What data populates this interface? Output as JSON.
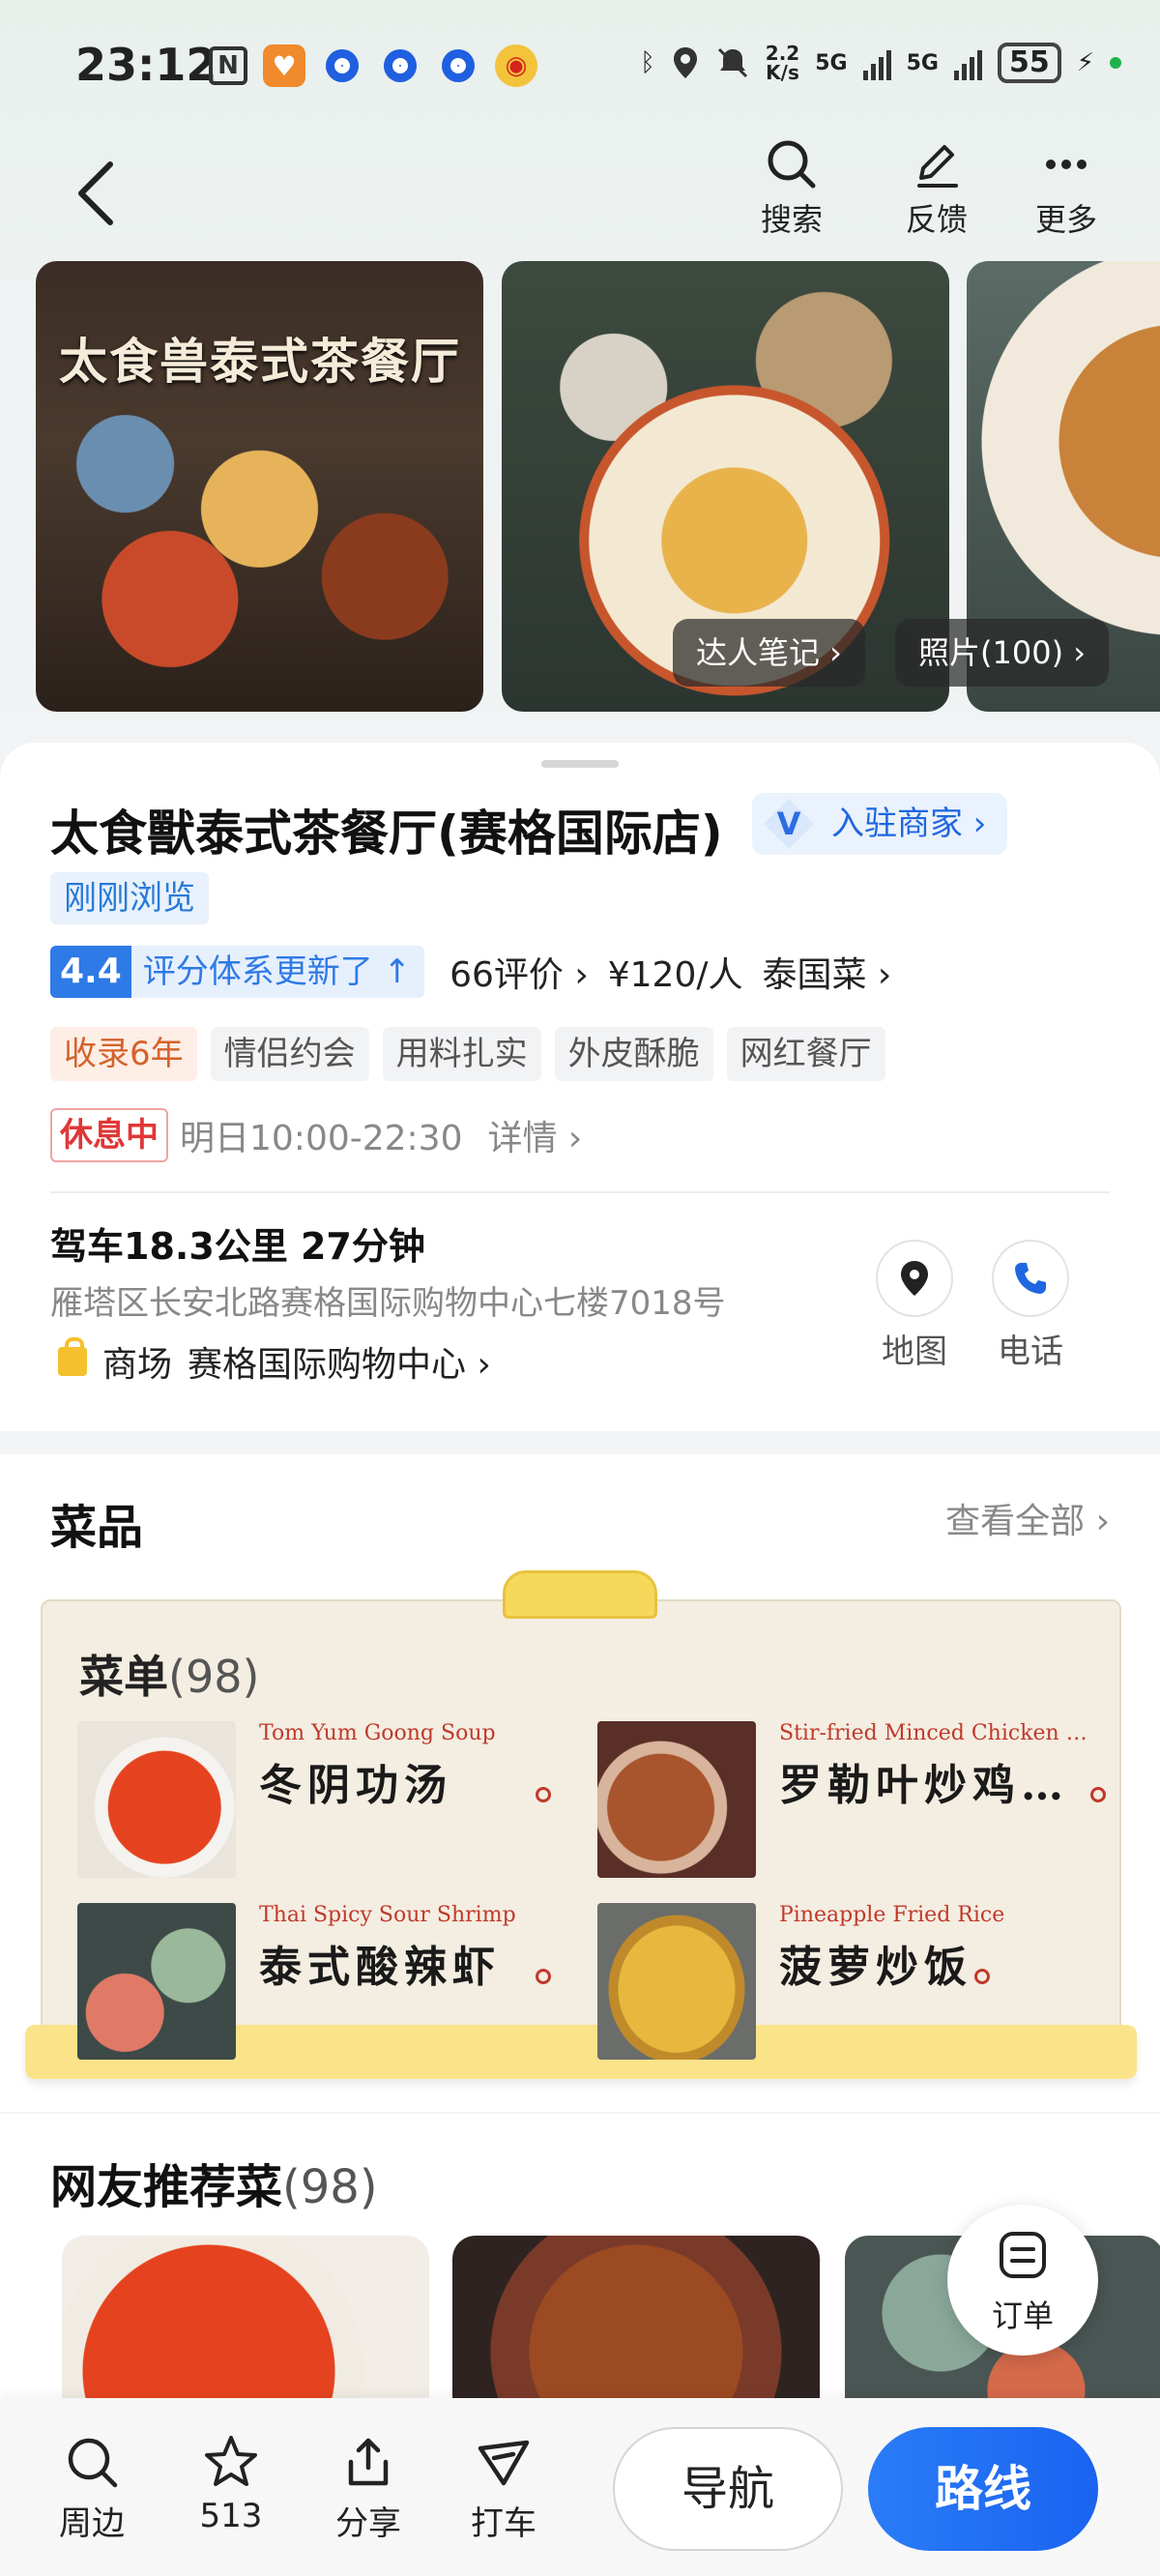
{
  "status_bar": {
    "time": "23:12",
    "net_speed_top": "2.2",
    "net_speed_bottom": "K/s",
    "network_1": "5G",
    "network_2": "5G",
    "battery": "55"
  },
  "nav": {
    "search_label": "搜索",
    "feedback_label": "反馈",
    "more_label": "更多"
  },
  "photos": {
    "photo1_text": "太食兽泰式茶餐厅",
    "notes_chip": "达人笔记 ›",
    "photos_chip": "照片(100) ›"
  },
  "shop": {
    "name": "太食獸泰式茶餐厅(赛格国际店)",
    "merchant_badge": "入驻商家 ›",
    "recent_tag": "刚刚浏览",
    "rating_score": "4.4",
    "rating_note": "评分体系更新了 ↑",
    "reviews": "66评价 ›",
    "price": "¥120/人",
    "cuisine": "泰国菜 ›",
    "tags": [
      "收录6年",
      "情侣约会",
      "用料扎实",
      "外皮酥脆",
      "网红餐厅"
    ],
    "status": "休息中",
    "hours": "明日10:00-22:30",
    "hours_details": "详情 ›",
    "drive_info": "驾车18.3公里 27分钟",
    "address": "雁塔区长安北路赛格国际购物中心七楼7018号",
    "mall_label": "商场",
    "mall_name": "赛格国际购物中心 ›",
    "map_label": "地图",
    "phone_label": "电话"
  },
  "dishes": {
    "title": "菜品",
    "view_all": "查看全部 ›",
    "menu_title": "菜单",
    "menu_count": "(98)",
    "items": [
      {
        "en": "Tom Yum Goong Soup",
        "cn": "冬阴功汤"
      },
      {
        "en": "Stir-fried Minced Chicken with…",
        "cn": "罗勒叶炒鸡…"
      },
      {
        "en": "Thai Spicy Sour Shrimp",
        "cn": "泰式酸辣虾"
      },
      {
        "en": "Pineapple Fried Rice",
        "cn": "菠萝炒饭"
      }
    ]
  },
  "recommended": {
    "title": "网友推荐菜",
    "count": "(98)"
  },
  "order_fab": {
    "label": "订单"
  },
  "bottom_bar": {
    "nearby": "周边",
    "favorites": "513",
    "share": "分享",
    "taxi": "打车",
    "navigate": "导航",
    "route": "路线"
  },
  "colors": {
    "accent_blue": "#2a7cf7",
    "closed_red": "#e03636",
    "menu_red": "#c0392b"
  }
}
